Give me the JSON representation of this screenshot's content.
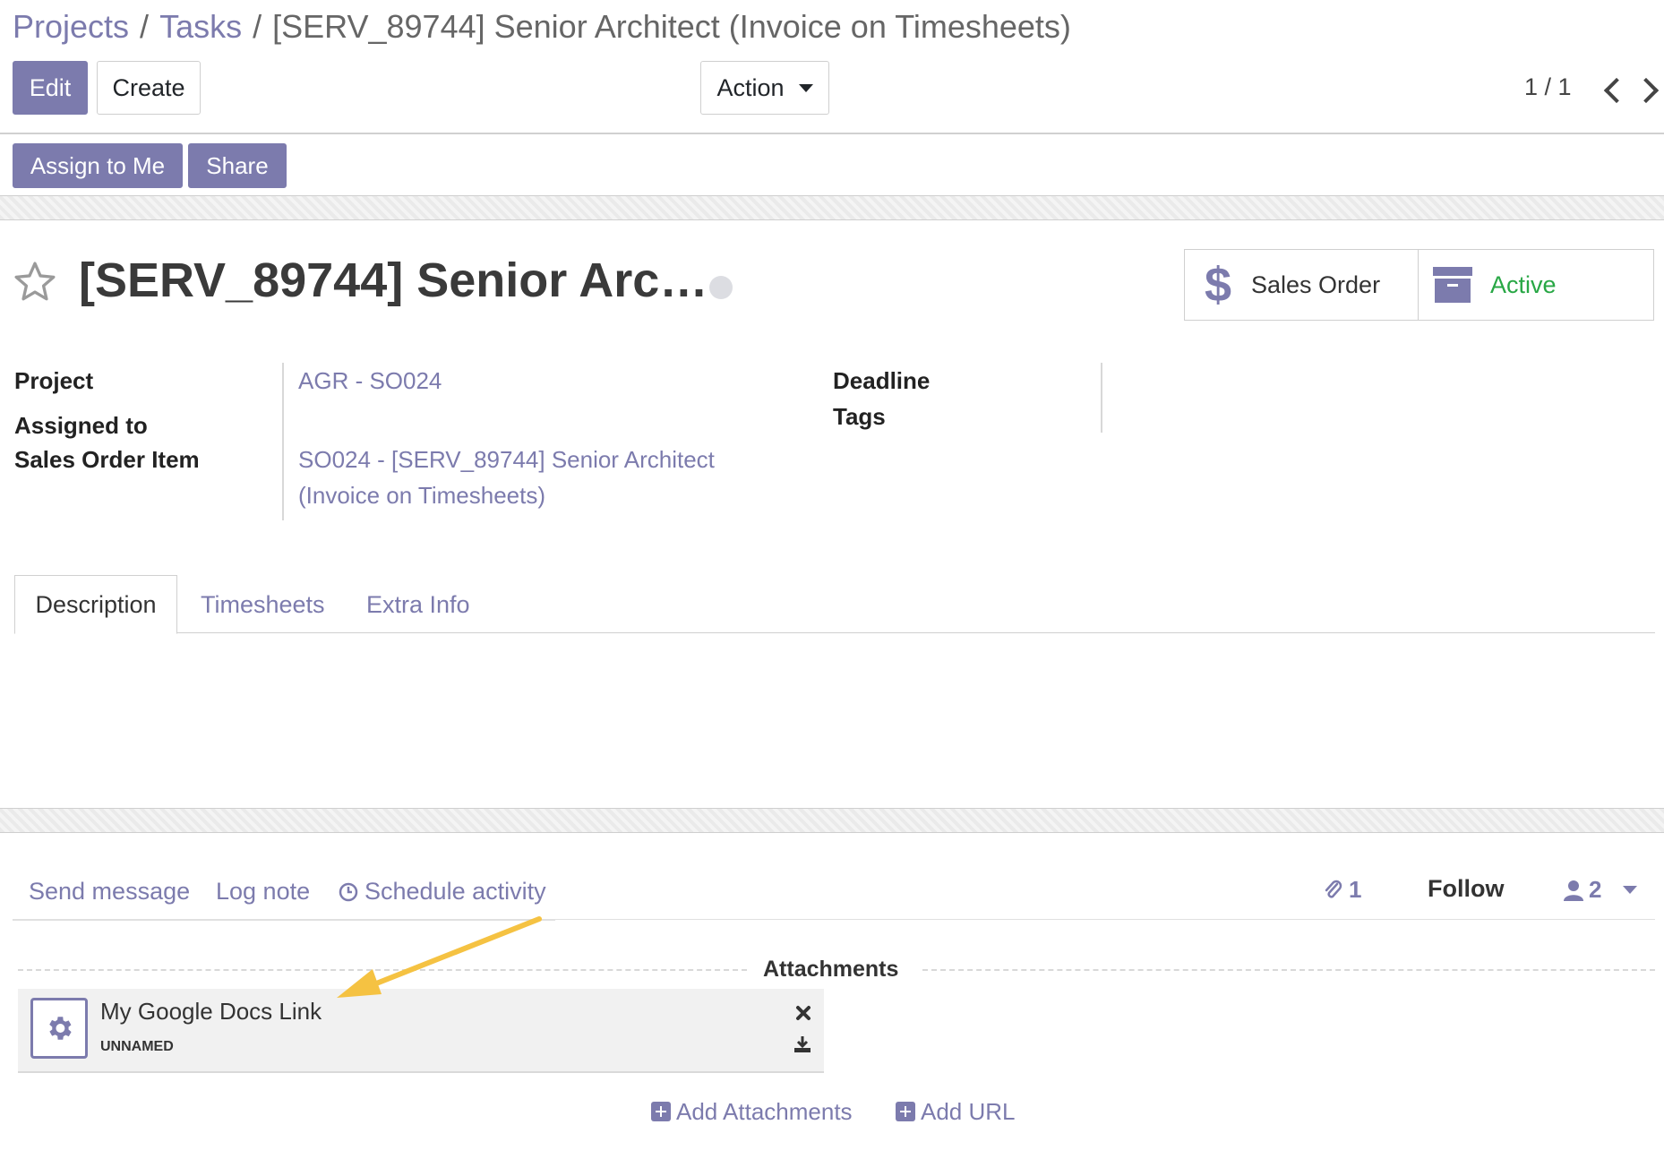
{
  "breadcrumb": {
    "projects": "Projects",
    "tasks": "Tasks",
    "current": "[SERV_89744] Senior Architect (Invoice on Timesheets)",
    "separator": "/"
  },
  "toolbar": {
    "edit_label": "Edit",
    "create_label": "Create",
    "action_label": "Action",
    "pager": "1 / 1"
  },
  "header_buttons": {
    "assign_to_me": "Assign to Me",
    "share": "Share"
  },
  "task": {
    "title": "[SERV_89744] Senior Arc…"
  },
  "smart_buttons": {
    "sales_order": "Sales Order",
    "active": "Active"
  },
  "fields": {
    "project_label": "Project",
    "project_value": "AGR - SO024",
    "assigned_label": "Assigned to",
    "sale_item_label": "Sales Order Item",
    "sale_item_value_line1": "SO024 - [SERV_89744] Senior Architect",
    "sale_item_value_line2": "(Invoice on Timesheets)",
    "deadline_label": "Deadline",
    "tags_label": "Tags"
  },
  "tabs": [
    {
      "label": "Description"
    },
    {
      "label": "Timesheets"
    },
    {
      "label": "Extra Info"
    }
  ],
  "chatter": {
    "send_message": "Send message",
    "log_note": "Log note",
    "schedule_activity": "Schedule activity",
    "attachment_count": "1",
    "follow": "Follow",
    "follower_count": "2",
    "attachments_title": "Attachments",
    "attachment_name": "My Google Docs Link",
    "attachment_sub": "UNNAMED",
    "add_attachments": "Add Attachments",
    "add_url": "Add URL"
  },
  "colors": {
    "brand": "#7c7bad",
    "active_green": "#28a745",
    "arrow_annotation": "#f5c242"
  },
  "icons": [
    "star-icon",
    "dollar-icon",
    "archive-icon",
    "clock-icon",
    "paperclip-icon",
    "user-icon",
    "gear-icon",
    "close-icon",
    "download-icon",
    "plus-square-icon",
    "chevron-left-icon",
    "chevron-right-icon"
  ]
}
